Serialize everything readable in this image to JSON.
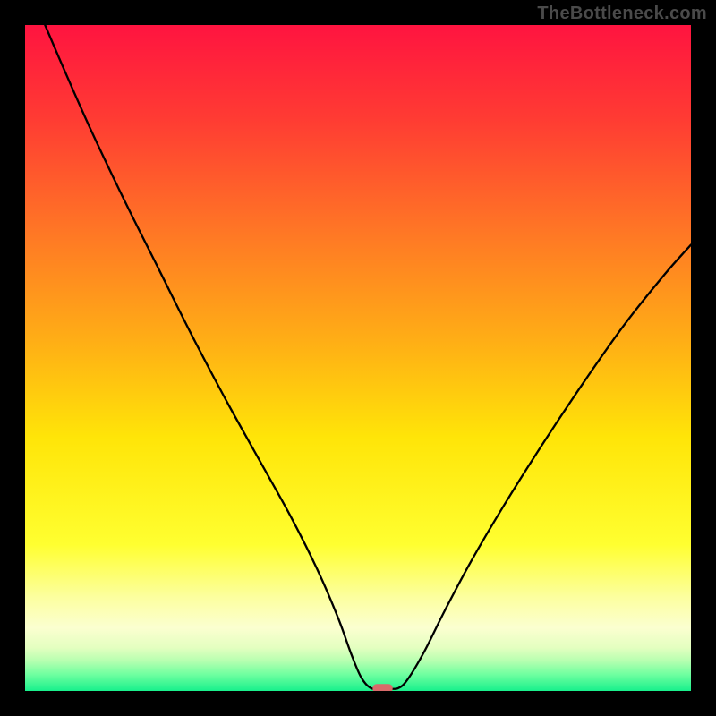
{
  "watermark": "TheBottleneck.com",
  "chart_data": {
    "type": "line",
    "title": "",
    "xlabel": "",
    "ylabel": "",
    "xlim": [
      0,
      100
    ],
    "ylim": [
      0,
      100
    ],
    "background_gradient": {
      "type": "vertical",
      "stops": [
        {
          "offset": 0.0,
          "color": "#ff1440"
        },
        {
          "offset": 0.14,
          "color": "#ff3b33"
        },
        {
          "offset": 0.3,
          "color": "#ff7326"
        },
        {
          "offset": 0.48,
          "color": "#ffb015"
        },
        {
          "offset": 0.62,
          "color": "#ffe508"
        },
        {
          "offset": 0.78,
          "color": "#ffff30"
        },
        {
          "offset": 0.86,
          "color": "#fcffa0"
        },
        {
          "offset": 0.905,
          "color": "#fbffd0"
        },
        {
          "offset": 0.935,
          "color": "#e4ffc0"
        },
        {
          "offset": 0.955,
          "color": "#b6ffb0"
        },
        {
          "offset": 0.975,
          "color": "#70ffa0"
        },
        {
          "offset": 1.0,
          "color": "#18f08c"
        }
      ]
    },
    "curve": {
      "stroke": "#000000",
      "stroke_width": 2.3,
      "points": [
        {
          "x": 3.0,
          "y": 100.0
        },
        {
          "x": 6.0,
          "y": 93.0
        },
        {
          "x": 10.0,
          "y": 84.0
        },
        {
          "x": 15.0,
          "y": 73.5
        },
        {
          "x": 20.0,
          "y": 63.5
        },
        {
          "x": 25.0,
          "y": 53.5
        },
        {
          "x": 30.0,
          "y": 44.0
        },
        {
          "x": 35.0,
          "y": 35.0
        },
        {
          "x": 40.0,
          "y": 26.0
        },
        {
          "x": 44.0,
          "y": 18.0
        },
        {
          "x": 47.0,
          "y": 11.0
        },
        {
          "x": 49.0,
          "y": 5.5
        },
        {
          "x": 50.5,
          "y": 2.0
        },
        {
          "x": 52.0,
          "y": 0.4
        },
        {
          "x": 54.0,
          "y": 0.4
        },
        {
          "x": 56.0,
          "y": 0.4
        },
        {
          "x": 57.5,
          "y": 1.8
        },
        {
          "x": 60.0,
          "y": 6.0
        },
        {
          "x": 63.0,
          "y": 12.0
        },
        {
          "x": 67.0,
          "y": 19.5
        },
        {
          "x": 72.0,
          "y": 28.0
        },
        {
          "x": 78.0,
          "y": 37.5
        },
        {
          "x": 84.0,
          "y": 46.5
        },
        {
          "x": 90.0,
          "y": 55.0
        },
        {
          "x": 96.0,
          "y": 62.5
        },
        {
          "x": 100.0,
          "y": 67.0
        }
      ]
    },
    "marker": {
      "shape": "rounded-rect",
      "x": 53.7,
      "y": 0.4,
      "width": 3.0,
      "height": 1.3,
      "rx": 0.6,
      "fill": "#d86a6a"
    }
  }
}
